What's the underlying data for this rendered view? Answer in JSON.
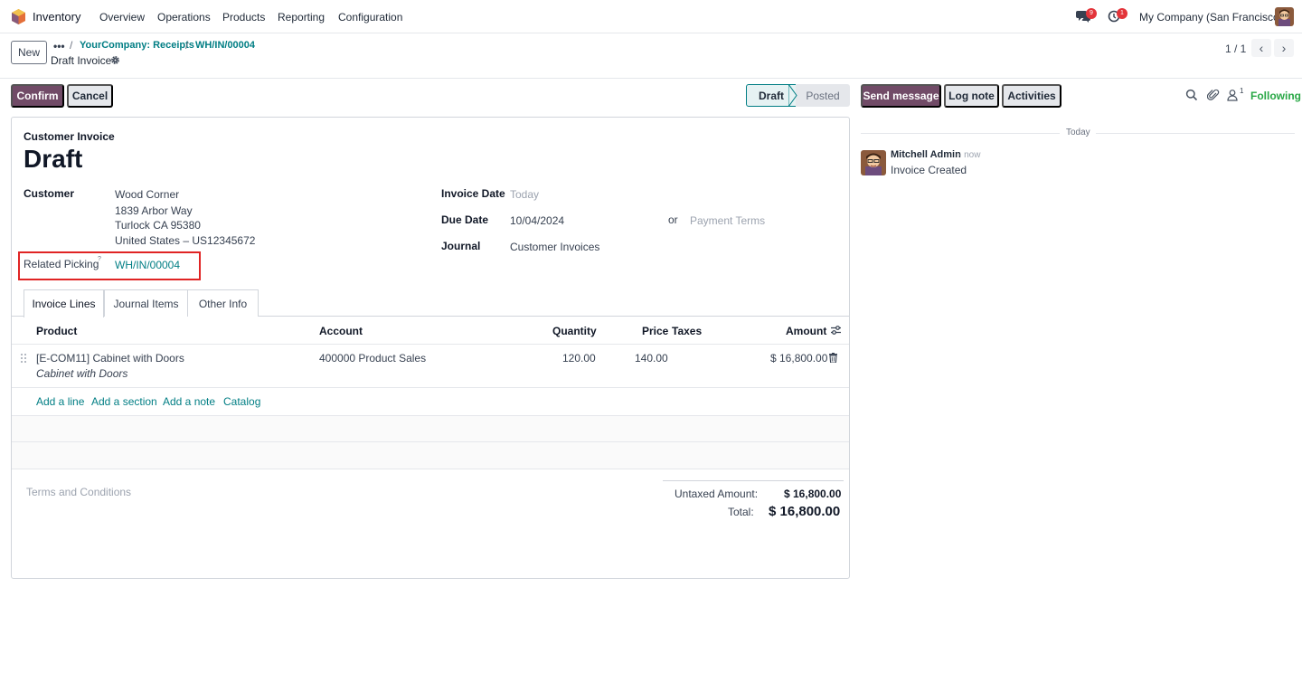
{
  "nav": {
    "app_name": "Inventory",
    "menus": [
      "Overview",
      "Operations",
      "Products",
      "Reporting",
      "Configuration"
    ],
    "messages_badge": "9",
    "activities_badge": "1",
    "company": "My Company (San Francisco)"
  },
  "control_panel": {
    "new_label": "New",
    "breadcrumb_dots": "•••",
    "breadcrumbs": [
      "YourCompany: Receipts",
      "WH/IN/00004"
    ],
    "title": "Draft Invoice",
    "pager": "1 / 1"
  },
  "actions": {
    "confirm": "Confirm",
    "cancel": "Cancel"
  },
  "status": {
    "draft": "Draft",
    "posted": "Posted"
  },
  "form": {
    "type_label": "Customer Invoice",
    "name": "Draft",
    "customer_label": "Customer",
    "customer_name": "Wood Corner",
    "address_line1": "1839 Arbor Way",
    "address_line2": "Turlock CA 95380",
    "address_line3": "United States – US12345672",
    "related_picking_label": "Related Picking",
    "related_picking_help": "?",
    "related_picking_value": "WH/IN/00004",
    "invoice_date_label": "Invoice Date",
    "invoice_date_placeholder": "Today",
    "due_date_label": "Due Date",
    "due_date_value": "10/04/2024",
    "or": "or",
    "payment_terms_placeholder": "Payment Terms",
    "journal_label": "Journal",
    "journal_value": "Customer Invoices"
  },
  "tabs": [
    "Invoice Lines",
    "Journal Items",
    "Other Info"
  ],
  "table": {
    "headers": {
      "product": "Product",
      "account": "Account",
      "quantity": "Quantity",
      "price": "Price",
      "taxes": "Taxes",
      "amount": "Amount"
    },
    "rows": [
      {
        "product": "[E-COM11] Cabinet with Doors",
        "description": "Cabinet with Doors",
        "account": "400000 Product Sales",
        "quantity": "120.00",
        "price": "140.00",
        "taxes": "",
        "amount": "$ 16,800.00"
      }
    ],
    "add_links": [
      "Add a line",
      "Add a section",
      "Add a note",
      "Catalog"
    ]
  },
  "terms_placeholder": "Terms and Conditions",
  "totals": {
    "untaxed_label": "Untaxed Amount:",
    "untaxed_value": "$ 16,800.00",
    "total_label": "Total:",
    "total_value": "$ 16,800.00"
  },
  "chatter": {
    "send_message": "Send message",
    "log_note": "Log note",
    "activities": "Activities",
    "followers_count": "1",
    "following": "Following",
    "date_separator": "Today",
    "messages": [
      {
        "author": "Mitchell Admin",
        "time": "- now",
        "body": "Invoice Created"
      }
    ]
  },
  "colors": {
    "primary": "#714b67",
    "link": "#017e84",
    "highlight_border": "#e02424",
    "badge": "#e3343a",
    "following": "#28a745"
  }
}
